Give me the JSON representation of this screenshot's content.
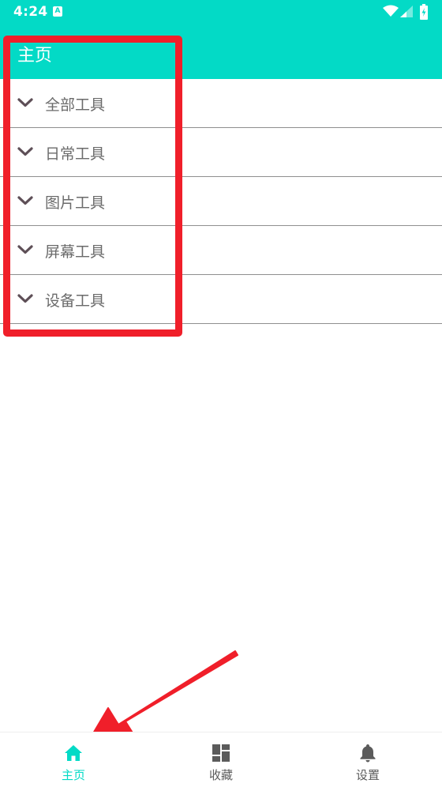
{
  "status_bar": {
    "time": "4:24",
    "notification_glyph": "A",
    "icons": [
      "wifi-icon",
      "cell-signal-icon",
      "battery-charging-icon"
    ]
  },
  "app_bar": {
    "title": "主页"
  },
  "categories": [
    {
      "label": "全部工具",
      "icon": "chevron-down-icon"
    },
    {
      "label": "日常工具",
      "icon": "chevron-down-icon"
    },
    {
      "label": "图片工具",
      "icon": "chevron-down-icon"
    },
    {
      "label": "屏幕工具",
      "icon": "chevron-down-icon"
    },
    {
      "label": "设备工具",
      "icon": "chevron-down-icon"
    }
  ],
  "bottom_nav": {
    "items": [
      {
        "label": "主页",
        "icon": "home-icon",
        "active": true
      },
      {
        "label": "收藏",
        "icon": "dashboard-icon",
        "active": false
      },
      {
        "label": "设置",
        "icon": "bell-icon",
        "active": false
      }
    ]
  },
  "colors": {
    "accent": "#03dac6",
    "annotation_red": "#f01f2a",
    "chevron": "#5e4f57",
    "inactive_icon": "#5b5b5b"
  }
}
